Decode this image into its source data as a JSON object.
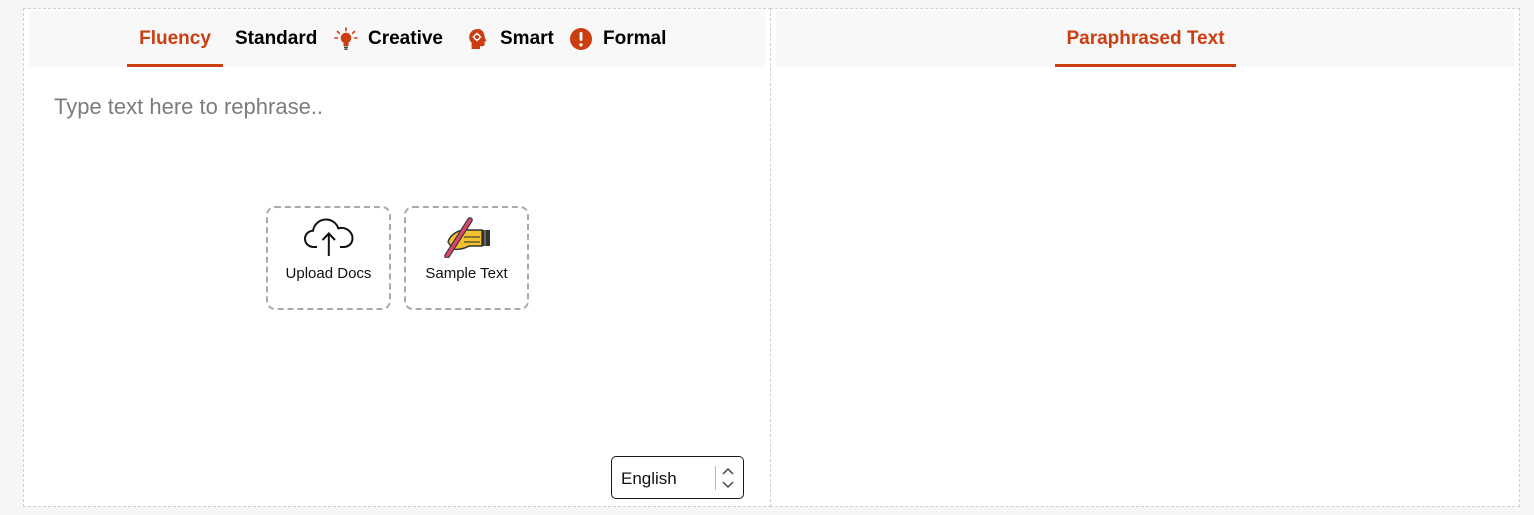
{
  "input_panel": {
    "tabs": [
      {
        "label": "Fluency",
        "icon": "none",
        "active": true
      },
      {
        "label": "Standard",
        "icon": "none",
        "active": false
      },
      {
        "label": "Creative",
        "icon": "lightbulb-icon",
        "active": false
      },
      {
        "label": "Smart",
        "icon": "brain-head-icon",
        "active": false
      },
      {
        "label": "Formal",
        "icon": "exclamation-icon",
        "active": false
      }
    ],
    "placeholder": "Type text here to rephrase..",
    "actions": {
      "upload_label": "Upload Docs",
      "sample_label": "Sample Text"
    },
    "language": {
      "selected": "English"
    }
  },
  "output_panel": {
    "tab_label": "Paraphrased Text"
  },
  "colors": {
    "accent": "#cc3d10",
    "tabbar_bg": "#f8f8f8",
    "placeholder": "#7c7c7c"
  }
}
